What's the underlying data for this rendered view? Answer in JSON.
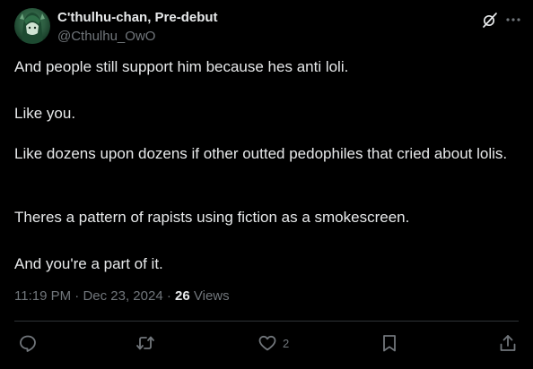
{
  "author": {
    "display_name": "C'thulhu-chan, Pre-debut",
    "handle": "@Cthulhu_OwO"
  },
  "post": {
    "paragraphs": [
      "And people still support him because hes anti loli.",
      "Like you.",
      "Like dozens upon dozens if other outted pedophiles that cried about lolis.",
      "Theres a pattern of rapists using fiction as a smokescreen.",
      "And you're a part of it."
    ]
  },
  "meta": {
    "time": "11:19 PM",
    "separator": "·",
    "date": "Dec 23, 2024",
    "views_count": "26",
    "views_label": "Views"
  },
  "actions": {
    "like_count": "2"
  },
  "icons": {
    "grok": "grok-icon",
    "more": "more-icon",
    "reply": "reply-icon",
    "repost": "repost-icon",
    "like": "heart-icon",
    "bookmark": "bookmark-icon",
    "share": "share-icon"
  },
  "colors": {
    "background": "#000000",
    "text": "#e7e9ea",
    "secondary": "#71767b",
    "divider": "#2f3336"
  }
}
